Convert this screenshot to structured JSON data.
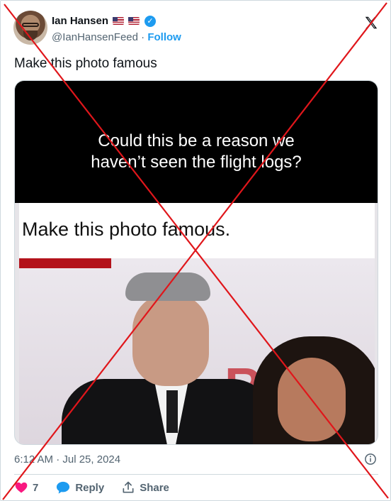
{
  "author": {
    "name": "Ian Hansen",
    "handle": "@IanHansenFeed",
    "separator": "·",
    "follow_label": "Follow"
  },
  "tweet": {
    "text": "Make this photo famous",
    "timestamp": "6:12 AM · Jul 25, 2024"
  },
  "media": {
    "caption_top": "Could this be a reason we haven’t seen the flight logs?",
    "caption_band": "Make this photo famous.",
    "wall_text": "R("
  },
  "actions": {
    "like_count": "7",
    "reply_label": "Reply",
    "share_label": "Share"
  },
  "colors": {
    "accent": "#1d9bf0",
    "like": "#f91880",
    "overlay_x": "#e0161b"
  },
  "icons": [
    "x-logo-icon",
    "verified-badge-icon",
    "us-flag-icon",
    "info-icon",
    "heart-icon",
    "reply-bubble-icon",
    "share-icon"
  ]
}
